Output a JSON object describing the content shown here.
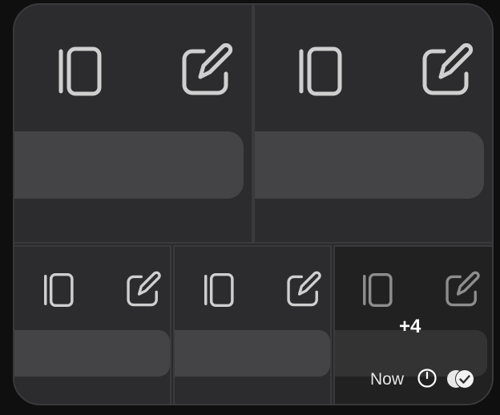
{
  "message": {
    "overflow_count": "+4",
    "timestamp": "Now"
  },
  "icons": {
    "sidebar": "sidebar-icon",
    "compose": "compose-icon",
    "clock": "clock-icon",
    "read_receipt": "double-check-icon"
  },
  "colors": {
    "background": "#0f0f10",
    "bubble": "#2b2b2d",
    "tile": "#2c2c2e",
    "field": "#444446",
    "border": "#3a3a3c",
    "text": "#ffffff"
  }
}
